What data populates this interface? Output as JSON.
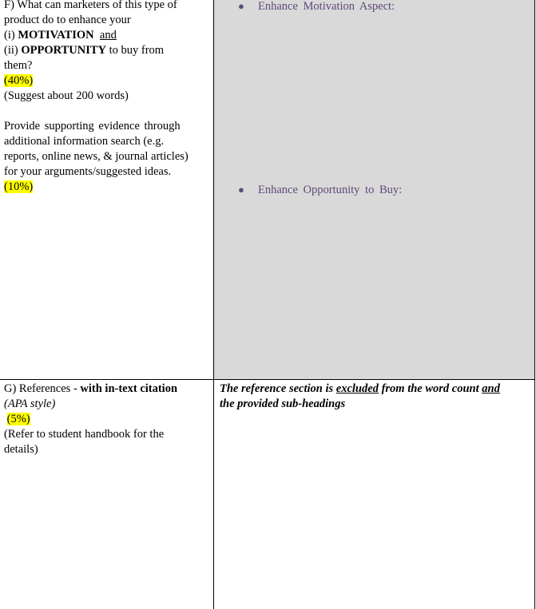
{
  "section_f": {
    "question": {
      "line1": "F) What can marketers of this type of",
      "line2": "product do to enhance your",
      "line3_prefix": "(i) ",
      "line3_bold": "MOTIVATION",
      "line3_underlined": "and",
      "line4_prefix": "(ii) ",
      "line4_bold": "OPPORTUNITY",
      "line4_suffix": " to buy from",
      "line5": "them?",
      "weight_highlight": "(40%)",
      "word_suggestion": "(Suggest about 200 words)"
    },
    "evidence": {
      "line1": "Provide supporting evidence through",
      "line2": "additional information search (e.g.",
      "line3": "reports, online news, & journal articles)",
      "line4": "for your arguments/suggested ideas.",
      "weight_highlight": "(10%)"
    },
    "answer_bullets": [
      {
        "icon": "bullet",
        "label": "Enhance Motivation Aspect:"
      },
      {
        "icon": "bullet",
        "label": "Enhance Opportunity to Buy:"
      }
    ],
    "answer_text_color": "#5f497a",
    "answer_background": "#d9d9d9"
  },
  "section_g": {
    "title_prefix": "G) References - ",
    "title_bold": "with in-text citation",
    "style_note": "(APA style)",
    "weight_highlight": "(5%)",
    "handbook_line1": "(Refer to student handbook for the",
    "handbook_line2": "details)",
    "answer_note": {
      "part1": "The reference section is ",
      "underlined1": "excluded",
      "part2": " from the word count ",
      "underlined2": "and",
      "line2": "the provided sub-headings"
    }
  },
  "highlight_color": "#ffff00"
}
